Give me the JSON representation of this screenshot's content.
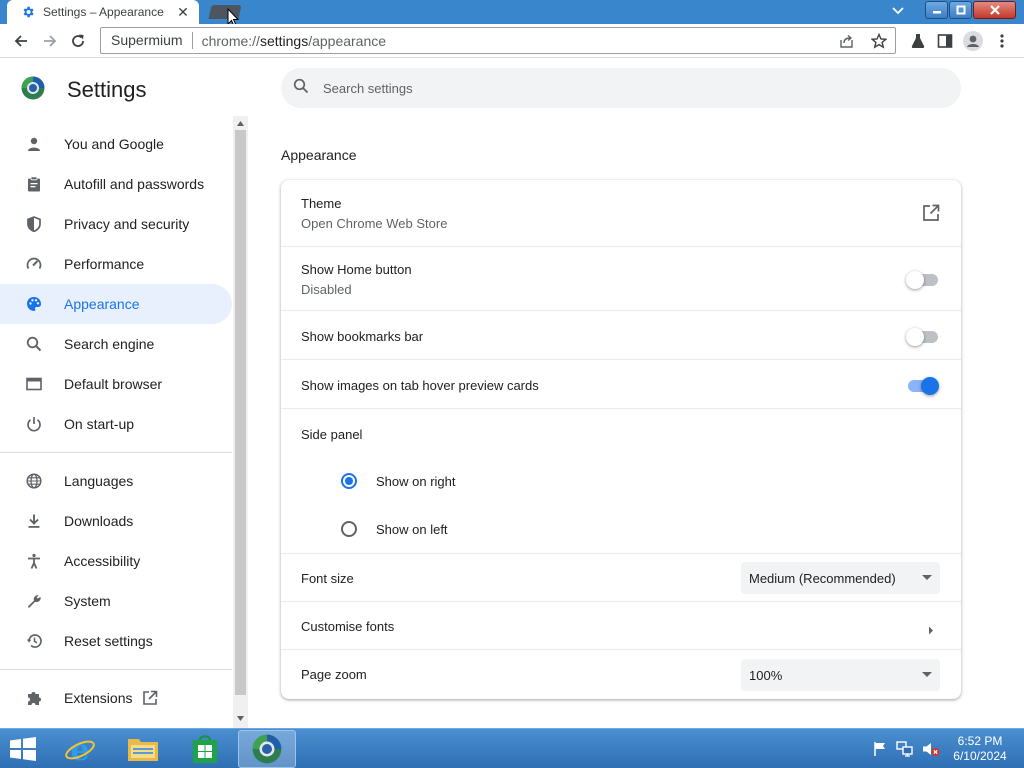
{
  "browser": {
    "tab_title": "Settings – Appearance",
    "tab_close": "✕",
    "site_chip": "Supermium",
    "url_scheme": "chrome://",
    "url_host": "settings",
    "url_path": "/appearance"
  },
  "header": {
    "title": "Settings",
    "search_placeholder": "Search settings"
  },
  "sidebar": {
    "items": [
      {
        "label": "You and Google",
        "icon": "person-icon"
      },
      {
        "label": "Autofill and passwords",
        "icon": "clipboard-icon"
      },
      {
        "label": "Privacy and security",
        "icon": "shield-icon"
      },
      {
        "label": "Performance",
        "icon": "speedometer-icon"
      },
      {
        "label": "Appearance",
        "icon": "palette-icon",
        "active": true
      },
      {
        "label": "Search engine",
        "icon": "search-icon"
      },
      {
        "label": "Default browser",
        "icon": "browser-window-icon"
      },
      {
        "label": "On start-up",
        "icon": "power-icon"
      },
      {
        "label": "Languages",
        "icon": "globe-icon"
      },
      {
        "label": "Downloads",
        "icon": "download-icon"
      },
      {
        "label": "Accessibility",
        "icon": "accessibility-icon"
      },
      {
        "label": "System",
        "icon": "wrench-icon"
      },
      {
        "label": "Reset settings",
        "icon": "history-icon"
      },
      {
        "label": "Extensions",
        "icon": "puzzle-icon"
      }
    ]
  },
  "main": {
    "section_title": "Appearance",
    "theme_label": "Theme",
    "theme_sub": "Open Chrome Web Store",
    "home_label": "Show Home button",
    "home_sub": "Disabled",
    "home_on": false,
    "bookmarks_label": "Show bookmarks bar",
    "bookmarks_on": false,
    "hover_label": "Show images on tab hover preview cards",
    "hover_on": true,
    "side_panel_label": "Side panel",
    "side_right": "Show on right",
    "side_left": "Show on left",
    "side_selected": "right",
    "font_size_label": "Font size",
    "font_size_value": "Medium (Recommended)",
    "customise_fonts_label": "Customise fonts",
    "page_zoom_label": "Page zoom",
    "page_zoom_value": "100%"
  },
  "taskbar": {
    "time": "6:52 PM",
    "date": "6/10/2024"
  },
  "colors": {
    "accent": "#1a73e8",
    "titlebar": "#3a86cc",
    "active_nav_bg": "#e8f0fe"
  }
}
